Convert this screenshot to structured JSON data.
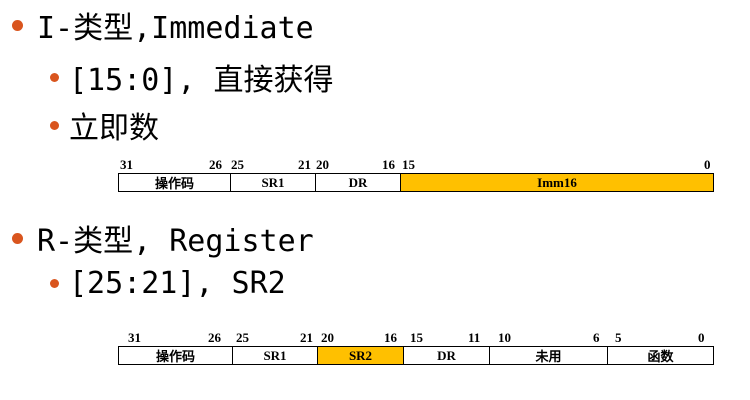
{
  "bullets": {
    "i_type": "I-类型,Immediate",
    "i_sub1": "[15:0], 直接获得",
    "i_sub2": "立即数",
    "r_type": "R-类型, Register",
    "r_sub1": "[25:21], SR2"
  },
  "i_format": {
    "bits": [
      "31",
      "26",
      "25",
      "21",
      "20",
      "16",
      "15",
      "0"
    ],
    "fields": [
      "操作码",
      "SR1",
      "DR",
      "Imm16"
    ]
  },
  "r_format": {
    "bits": [
      "31",
      "26",
      "25",
      "21",
      "20",
      "16",
      "15",
      "11",
      "10",
      "6",
      "5",
      "0"
    ],
    "fields": [
      "操作码",
      "SR1",
      "SR2",
      "DR",
      "未用",
      "函数"
    ]
  },
  "colors": {
    "bullet": "#d9551e",
    "highlight": "#ffc000"
  }
}
